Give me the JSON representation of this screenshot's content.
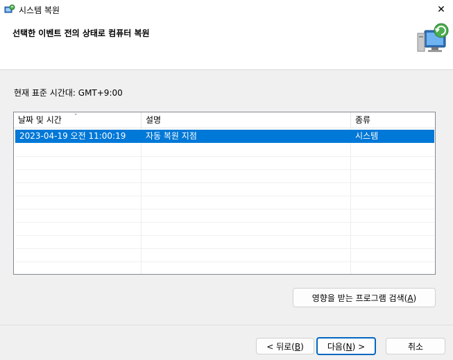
{
  "window": {
    "title": "시스템 복원",
    "close_glyph": "✕"
  },
  "header": {
    "title": "선택한 이벤트 전의 상태로 컴퓨터 복원"
  },
  "timezone": {
    "label": "현재 표준 시간대: GMT+9:00"
  },
  "table": {
    "columns": [
      "날짜 및 시간",
      "설명",
      "종류"
    ],
    "sort_indicator": "ˇ",
    "rows": [
      {
        "date": "2023-04-19 오전 11:00:19",
        "description": "자동 복원 지점",
        "type": "시스템"
      }
    ],
    "selection_color": "#0078d7"
  },
  "buttons": {
    "scan_pre": "영향을 받는 프로그램 검색(",
    "scan_key": "A",
    "scan_post": ")",
    "back_pre": "< 뒤로(",
    "back_key": "B",
    "back_post": ")",
    "next_pre": "다음(",
    "next_key": "N",
    "next_post": ") >",
    "cancel": "취소"
  }
}
